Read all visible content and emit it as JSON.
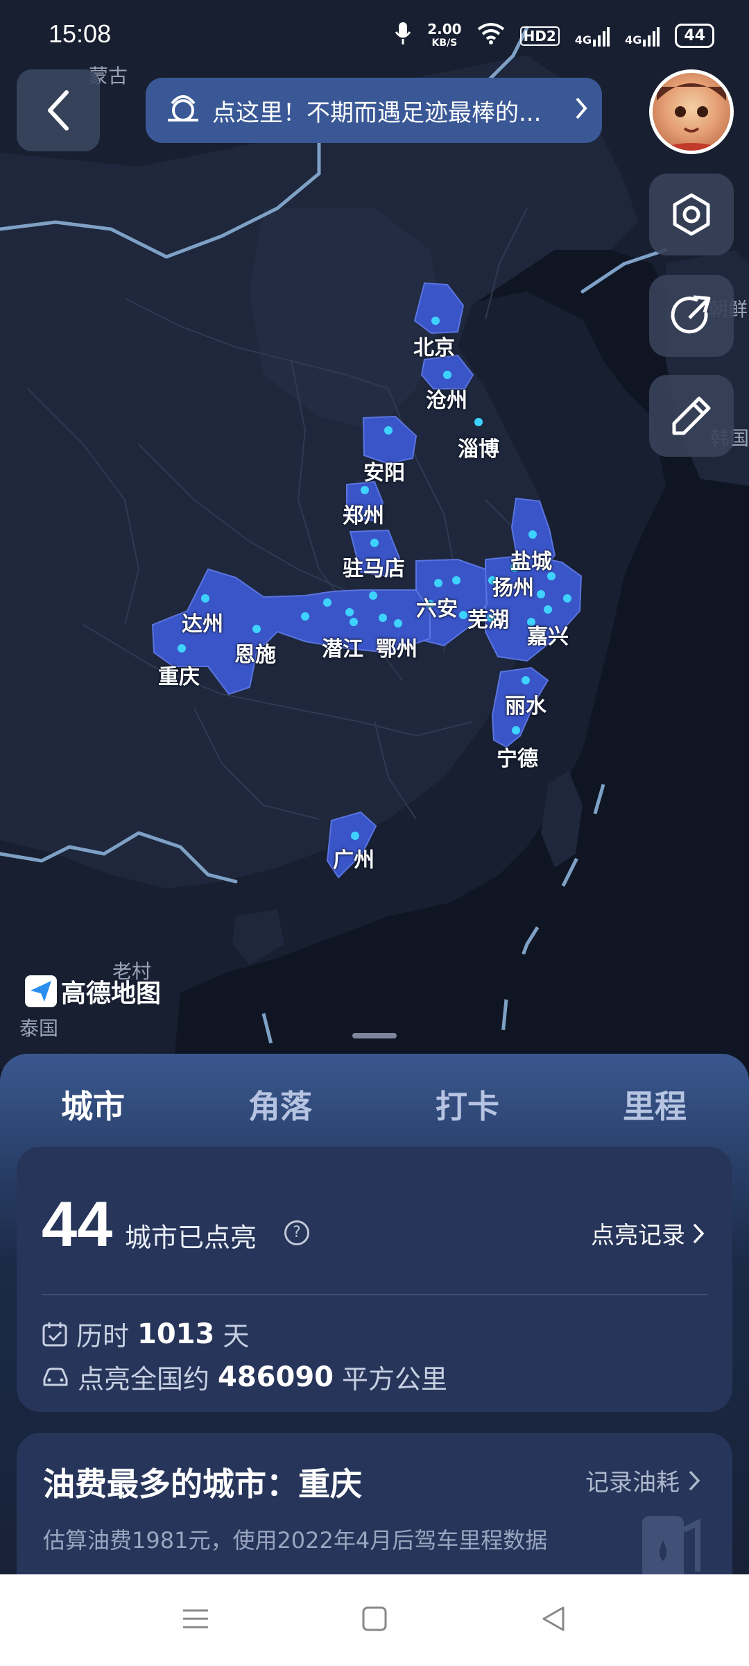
{
  "status_bar": {
    "time": "15:08",
    "net_speed_value": "2.00",
    "net_speed_unit": "KB/S",
    "hd": "HD2",
    "signal1": "4G",
    "signal2": "4G",
    "battery": "44"
  },
  "top": {
    "notice_text": "点这里！不期而遇足迹最棒的..."
  },
  "map": {
    "region_labels": [
      "蒙古",
      "老村",
      "泰国",
      "韩国",
      "朝鲜"
    ],
    "cities": [
      "北京",
      "沧州",
      "淄博",
      "安阳",
      "郑州",
      "驻马店",
      "盐城",
      "扬州",
      "六安",
      "芜湖",
      "嘉兴",
      "达州",
      "恩施",
      "重庆",
      "潜江",
      "鄂州",
      "丽水",
      "宁德",
      "广州"
    ],
    "logo_text": "高德地图",
    "highlight_color": "#3a55c8",
    "dot_color": "#3ed3ff"
  },
  "tabs": [
    "城市",
    "角落",
    "打卡",
    "里程"
  ],
  "summary": {
    "city_count": "44",
    "city_count_label": "城市已点亮",
    "help_mark": "?",
    "record_link": "点亮记录",
    "duration_prefix": "历时",
    "duration_value": "1013",
    "duration_unit": "天",
    "area_prefix": "点亮全国约",
    "area_value": "486090",
    "area_unit": "平方公里"
  },
  "fuel": {
    "title": "油费最多的城市：重庆",
    "link": "记录油耗",
    "subtitle": "估算油费1981元，使用2022年4月后驾车里程数据"
  }
}
